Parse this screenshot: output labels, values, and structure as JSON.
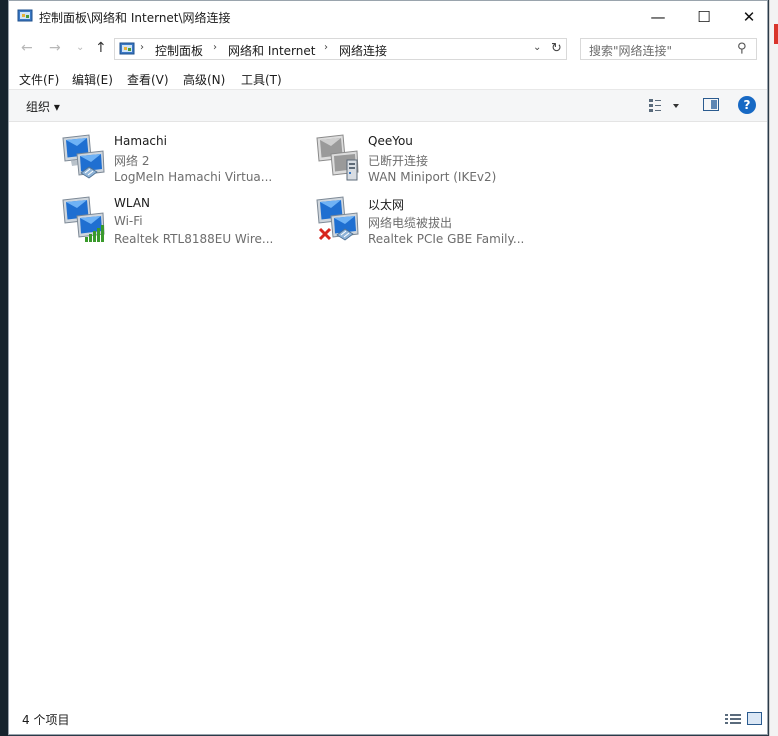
{
  "window": {
    "title": "控制面板\\网络和 Internet\\网络连接"
  },
  "caption": {
    "minimize": "—",
    "maximize": "☐",
    "close": "✕"
  },
  "nav": {
    "back": "←",
    "forward": "→",
    "recent": "⌄",
    "up": "↑"
  },
  "address": {
    "crumbs": [
      "控制面板",
      "网络和 Internet",
      "网络连接"
    ],
    "separator": "›",
    "dropdown": "⌄",
    "refresh": "↻"
  },
  "search": {
    "placeholder": "搜索\"网络连接\"",
    "icon": "⚲"
  },
  "menu": [
    "文件(F)",
    "编辑(E)",
    "查看(V)",
    "高级(N)",
    "工具(T)"
  ],
  "toolbar": {
    "organize": "组织 ▾",
    "help": "?"
  },
  "connections": [
    {
      "name": "Hamachi",
      "status": "网络  2",
      "device": "LogMeIn Hamachi Virtua..."
    },
    {
      "name": "QeeYou",
      "status": "已断开连接",
      "device": "WAN Miniport (IKEv2)"
    },
    {
      "name": "WLAN",
      "status": "Wi-Fi",
      "device": "Realtek RTL8188EU Wire..."
    },
    {
      "name": "以太网",
      "status": "网络电缆被拔出",
      "device": "Realtek PCIe GBE Family..."
    }
  ],
  "statusbar": {
    "count": "4 个项目"
  },
  "colors": {
    "accent": "#1769c4",
    "disconnected_x": "#d7261e",
    "signal": "#3a9a2c"
  }
}
